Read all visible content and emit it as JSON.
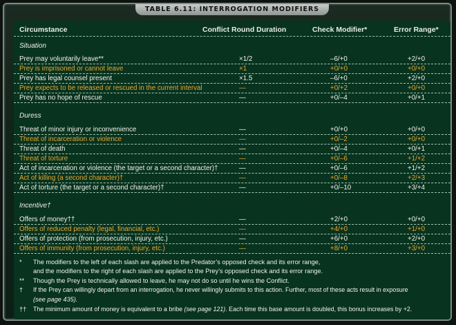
{
  "title": "TABLE 6.11: INTERROGATION MODIFIERS",
  "headers": {
    "circumstance": "Circumstance",
    "duration": "Conflict Round Duration",
    "check": "Check Modifier*",
    "error": "Error Range*"
  },
  "sections": [
    {
      "name": "Situation",
      "rows": [
        {
          "c": "Prey may voluntarily leave**",
          "d": "×1/2",
          "m": "–6/+0",
          "e": "+2/+0"
        },
        {
          "c": "Prey is imprisoned or cannot leave",
          "d": "×1",
          "m": "+0/+0",
          "e": "+0/+0"
        },
        {
          "c": "Prey has legal counsel present",
          "d": "×1.5",
          "m": "–6/+0",
          "e": "+2/+0"
        },
        {
          "c": "Prey expects to be released or rescued in the current interval",
          "d": "—",
          "m": "+0/+2",
          "e": "+0/+0"
        },
        {
          "c": "Prey has no hope of rescue",
          "d": "—",
          "m": "+0/–4",
          "e": "+0/+1"
        }
      ]
    },
    {
      "name": "Duress",
      "rows": [
        {
          "c": "Threat of minor injury or inconvenience",
          "d": "—",
          "m": "+0/+0",
          "e": "+0/+0"
        },
        {
          "c": "Threat of incarceration or violence",
          "d": "—",
          "m": "+0/–2",
          "e": "+0/+0"
        },
        {
          "c": "Threat of death",
          "d": "—",
          "m": "+0/–4",
          "e": "+0/+1"
        },
        {
          "c": "Threat of torture",
          "d": "—",
          "m": "+0/–6",
          "e": "+1/+2"
        },
        {
          "c": "Act of incarceration or violence (the target or a second character)†",
          "d": "—",
          "m": "+0/–6",
          "e": "+1/+2"
        },
        {
          "c": "Act of killing (a second character)†",
          "d": "—",
          "m": "+0/–8",
          "e": "+2/+3"
        },
        {
          "c": "Act of torture (the target or a second character)†",
          "d": "—",
          "m": "+0/–10",
          "e": "+3/+4"
        }
      ]
    },
    {
      "name": "Incentive†",
      "rows": [
        {
          "c": "Offers of money††",
          "d": "—",
          "m": "+2/+0",
          "e": "+0/+0"
        },
        {
          "c": "Offers of reduced penalty (legal, financial, etc.)",
          "d": "—",
          "m": "+4/+0",
          "e": "+1/+0"
        },
        {
          "c": "Offers of protection (from prosecution, injury, etc.)",
          "d": "—",
          "m": "+6/+0",
          "e": "+2/+0"
        },
        {
          "c": "Offers of immunity (from prosecution, injury, etc.)",
          "d": "—",
          "m": "+8/+0",
          "e": "+3/+0"
        }
      ]
    }
  ],
  "footnotes": {
    "f1_sym": "*",
    "f1_line1": "The modifiers to the left of each slash are applied to the Predator’s opposed check and its error range,",
    "f1_line2": "and the modifiers to the right of each slash are applied to the Prey’s opposed check and its error range.",
    "f2_sym": "**",
    "f2_text": "Though the Prey is technically allowed to leave, he may not do so until he wins the Conflict.",
    "f3_sym": "†",
    "f3_line1": "If the Prey can willingly depart from an interrogation, he never willingly submits to this action. Further, most of these acts result in exposure",
    "f3_line2": "(see page 435).",
    "f4_sym": "††",
    "f4_a": "The minimum amount of money is equivalent to a bribe ",
    "f4_ref": "(see page 121)",
    "f4_b": ". Each time this base amount is doubled, this bonus increases by +2."
  }
}
